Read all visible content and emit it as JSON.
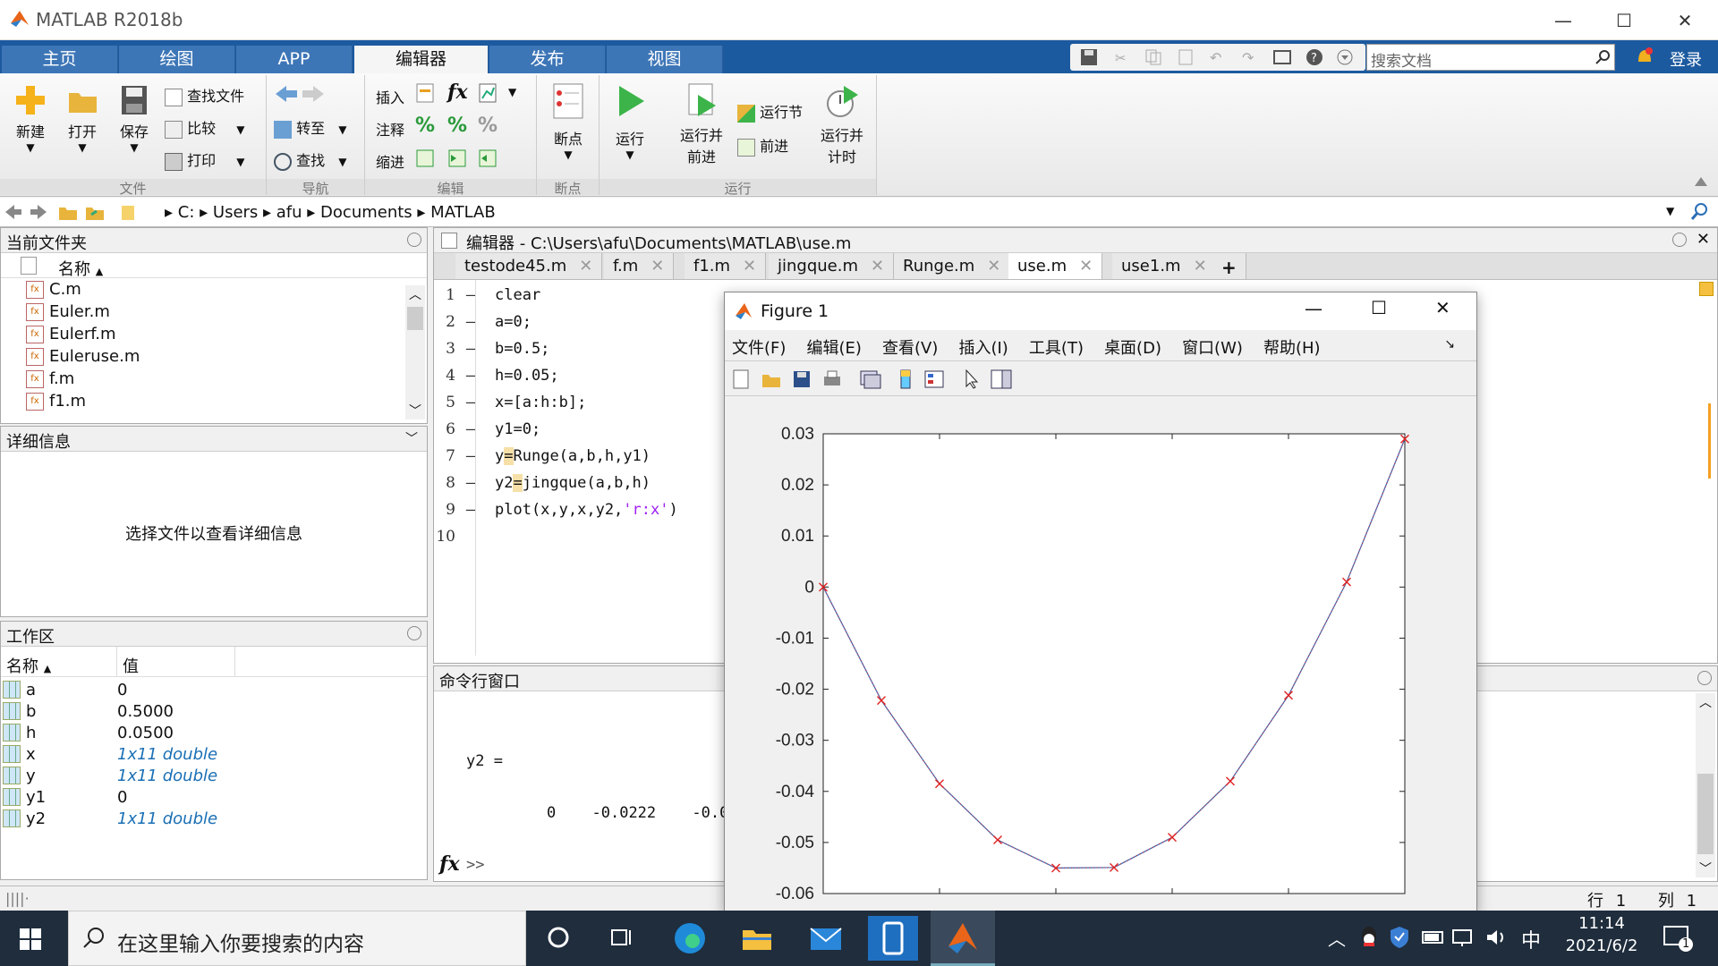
{
  "app": {
    "title": "MATLAB R2018b",
    "window_controls": [
      "minimize-icon",
      "maximize-icon",
      "close-icon"
    ]
  },
  "toolstrip": {
    "tabs": [
      "主页",
      "绘图",
      "APP",
      "编辑器",
      "发布",
      "视图"
    ],
    "selected_tab": "编辑器",
    "search_placeholder": "搜索文档",
    "login_label": "登录"
  },
  "ribbon": {
    "file": {
      "new": "新建",
      "open": "打开",
      "save": "保存",
      "find_files": "查找文件",
      "compare": "比较",
      "print": "打印",
      "group": "文件"
    },
    "navigate": {
      "goto": "转至",
      "find": "查找",
      "group": "导航"
    },
    "edit": {
      "insert": "插入",
      "comment": "注释",
      "indent": "缩进",
      "group": "编辑"
    },
    "breakpoints": {
      "label": "断点",
      "group": "断点"
    },
    "run": {
      "run": "运行",
      "run_advance_1": "运行并",
      "run_advance_2": "前进",
      "run_section": "运行节",
      "advance": "前进",
      "run_time_1": "运行并",
      "run_time_2": "计时",
      "group": "运行"
    }
  },
  "address": {
    "segments": [
      "C:",
      "Users",
      "afu",
      "Documents",
      "MATLAB"
    ]
  },
  "current_folder": {
    "title": "当前文件夹",
    "column": "名称",
    "files": [
      "C.m",
      "Euler.m",
      "Eulerf.m",
      "Euleruse.m",
      "f.m",
      "f1.m"
    ]
  },
  "details": {
    "title": "详细信息",
    "message": "选择文件以查看详细信息"
  },
  "workspace": {
    "title": "工作区",
    "col_name": "名称",
    "col_value": "值",
    "rows": [
      {
        "name": "a",
        "value": "0",
        "italic": false
      },
      {
        "name": "b",
        "value": "0.5000",
        "italic": false
      },
      {
        "name": "h",
        "value": "0.0500",
        "italic": false
      },
      {
        "name": "x",
        "value": "1x11 double",
        "italic": true
      },
      {
        "name": "y",
        "value": "1x11 double",
        "italic": true
      },
      {
        "name": "y1",
        "value": "0",
        "italic": false
      },
      {
        "name": "y2",
        "value": "1x11 double",
        "italic": true
      }
    ]
  },
  "editor": {
    "title": "编辑器 - C:\\Users\\afu\\Documents\\MATLAB\\use.m",
    "tabs": [
      "testode45.m",
      "f.m",
      "f1.m",
      "jingque.m",
      "Runge.m",
      "use.m",
      "use1.m"
    ],
    "selected_tab": "use.m",
    "lines": [
      {
        "n": "1",
        "dash": "—",
        "code": "clear"
      },
      {
        "n": "2",
        "dash": "—",
        "code": "a=0;"
      },
      {
        "n": "3",
        "dash": "—",
        "code": "b=0.5;"
      },
      {
        "n": "4",
        "dash": "—",
        "code": "h=0.05;"
      },
      {
        "n": "5",
        "dash": "—",
        "code": "x=[a:h:b];"
      },
      {
        "n": "6",
        "dash": "—",
        "code": "y1=0;"
      },
      {
        "n": "7",
        "dash": "—",
        "code_a": "y",
        "code_b": "=",
        "code_c": "Runge(a,b,h,y1)"
      },
      {
        "n": "8",
        "dash": "—",
        "code_a": "y2",
        "code_b": "=",
        "code_c": "jingque(a,b,h)"
      },
      {
        "n": "9",
        "dash": "—",
        "code_a": "plot(x,y,x,y2,",
        "code_str": "'r:x'",
        "code_c": ")"
      },
      {
        "n": "10",
        "dash": "",
        "code": ""
      }
    ]
  },
  "command_window": {
    "title": "命令行窗口",
    "var_line": "y2 =",
    "values": [
      "0",
      "-0.0222",
      "-0.038"
    ],
    "prompt": ">>"
  },
  "figure": {
    "title": "Figure 1",
    "menu": [
      "文件(F)",
      "编辑(E)",
      "查看(V)",
      "插入(I)",
      "工具(T)",
      "桌面(D)",
      "窗口(W)",
      "帮助(H)"
    ]
  },
  "status": {
    "row_label": "行",
    "row_value": "1",
    "col_label": "列",
    "col_value": "1"
  },
  "taskbar": {
    "search_placeholder": "在这里输入你要搜索的内容",
    "time": "11:14",
    "date": "2021/6/2",
    "ime": "中",
    "notification_count": "1"
  },
  "chart_data": {
    "type": "line",
    "x": [
      0,
      0.05,
      0.1,
      0.15,
      0.2,
      0.25,
      0.3,
      0.35,
      0.4,
      0.45,
      0.5
    ],
    "xlim": [
      0,
      0.5
    ],
    "ylim": [
      -0.06,
      0.03
    ],
    "yticks": [
      "0.03",
      "0.02",
      "0.01",
      "0",
      "-0.01",
      "-0.02",
      "-0.03",
      "-0.04",
      "-0.05",
      "-0.06"
    ],
    "series": [
      {
        "style": "solid",
        "color": "#4a6fb5",
        "values": [
          0,
          -0.0222,
          -0.0385,
          -0.0495,
          -0.055,
          -0.0549,
          -0.049,
          -0.038,
          -0.0212,
          0.001,
          0.029
        ]
      },
      {
        "style": "dotted-x-markers",
        "color": "#e02020",
        "values": [
          0,
          -0.0222,
          -0.0385,
          -0.0495,
          -0.055,
          -0.0549,
          -0.049,
          -0.038,
          -0.0212,
          0.001,
          0.029
        ]
      }
    ],
    "grid": false
  }
}
